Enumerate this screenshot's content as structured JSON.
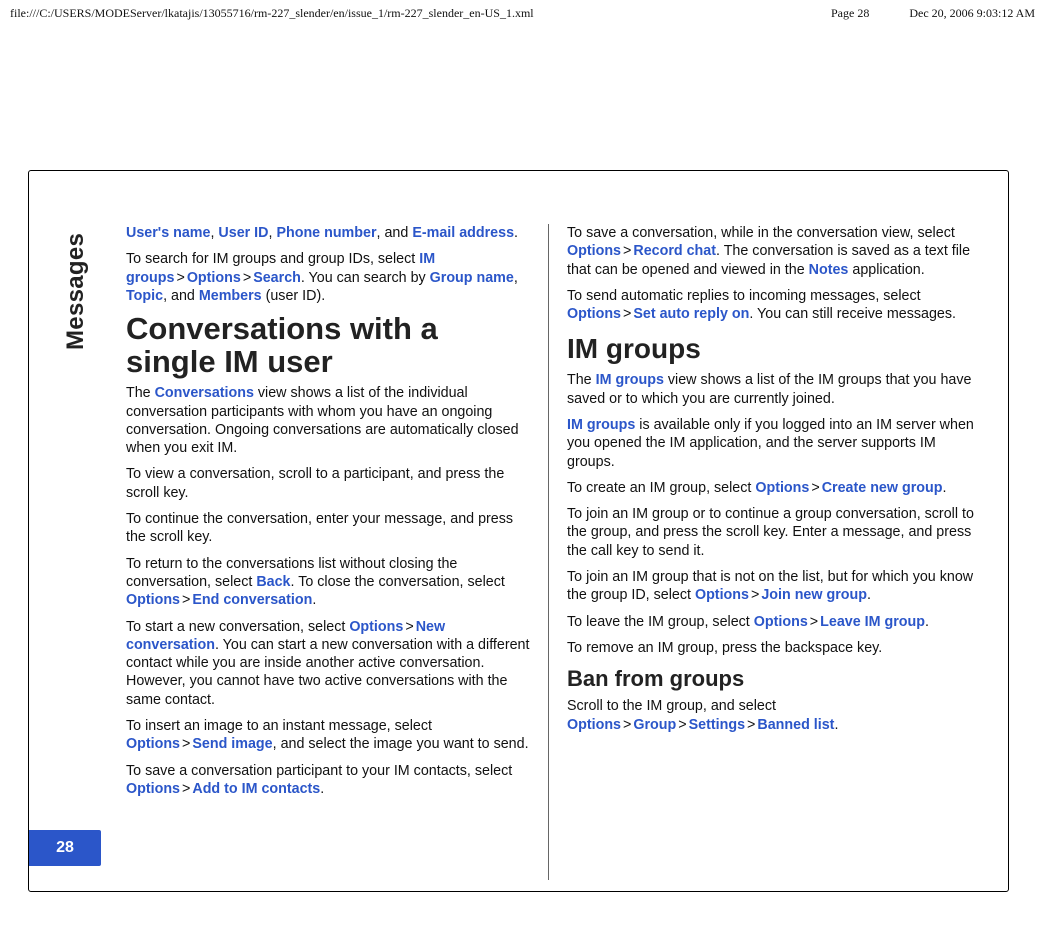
{
  "topbar": {
    "path": "file:///C:/USERS/MODEServer/lkatajis/13055716/rm-227_slender/en/issue_1/rm-227_slender_en-US_1.xml",
    "page_label": "Page 28",
    "timestamp": "Dec 20, 2006 9:03:12 AM"
  },
  "side_tab": "Messages",
  "page_number": "28",
  "left": {
    "intro_pre": ", ",
    "user_name": "User's name",
    "user_id": "User ID",
    "phone_number": "Phone number",
    "and1": ", and ",
    "email_addr": "E-mail address",
    "dot1": ".",
    "p2_a": "To search for IM groups and group IDs, select ",
    "im_groups": "IM groups",
    "options1": "Options",
    "search1": "Search",
    "p2_b": ". You can search by ",
    "group_name": "Group name",
    "topic": "Topic",
    "members": "Members",
    "p2_c": " (user ID).",
    "h_conv": "Conversations with a single IM user",
    "conv_view_a": "The ",
    "conversations": "Conversations",
    "conv_view_b": " view shows a list of the individual conversation participants with whom you have an ongoing conversation. Ongoing conversations are automatically closed when you exit IM.",
    "p_view": "To view a conversation, scroll to a participant, and press the scroll key.",
    "p_continue": "To continue the conversation, enter your message, and press the scroll key.",
    "p_return_a": "To return to the conversations list without closing the conversation, select ",
    "back": "Back",
    "p_return_b": ". To close the conversation, select ",
    "options2": "Options",
    "end_conv": "End conversation",
    "dot2": ".",
    "p_newconv_a": "To start a new conversation, select ",
    "options3": "Options",
    "new_conv": "New conversation",
    "p_newconv_b": ". You can start a new conversation with a different contact while you are inside another active conversation. However, you cannot have two active conversations with the same contact.",
    "p_image_a": "To insert an image to an instant message, select ",
    "options4": "Options",
    "send_image": "Send image",
    "p_image_b": ", and select the image you want to send.",
    "p_saveconv_a": "To save a conversation participant to your IM contacts, select ",
    "options5": "Options",
    "add_contacts": "Add to IM contacts",
    "dot3": "."
  },
  "right": {
    "p_record_a": "To save a conversation, while in the conversation view, select ",
    "options6": "Options",
    "record_chat": "Record chat",
    "p_record_b": ". The conversation is saved as a text file that can be opened and viewed in the ",
    "notes": "Notes",
    "p_record_c": " application.",
    "p_auto_a": "To send automatic replies to incoming messages, select ",
    "options7": "Options",
    "set_auto": "Set auto reply on",
    "p_auto_b": ". You can still receive messages.",
    "h_groups": "IM groups",
    "p_gview_a": "The ",
    "im_groups2": "IM groups",
    "p_gview_b": " view shows a list of the IM groups that you have saved or to which you are currently joined.",
    "p_gavail_a": "",
    "im_groups3": "IM groups",
    "p_gavail_b": " is available only if you logged into an IM server when you opened the IM application, and the server supports IM groups.",
    "p_create_a": "To create an IM group, select ",
    "options8": "Options",
    "create_group": "Create new group",
    "dot4": ".",
    "p_join": "To join an IM group or to continue a group conversation, scroll to the group, and press the scroll key. Enter a message, and press the call key to send it.",
    "p_joinnew_a": "To join an IM group that is not on the list, but for which you know the group ID, select ",
    "options9": "Options",
    "join_group": "Join new group",
    "dot5": ".",
    "p_leave_a": "To leave the IM group, select ",
    "options10": "Options",
    "leave_group": "Leave IM group",
    "dot6": ".",
    "p_remove": "To remove an IM group, press the backspace key.",
    "h_ban": "Ban from groups",
    "p_ban_a": "Scroll to the IM group, and select ",
    "options11": "Options",
    "group": "Group",
    "settings": "Settings",
    "banned_list": "Banned list",
    "dot7": "."
  }
}
